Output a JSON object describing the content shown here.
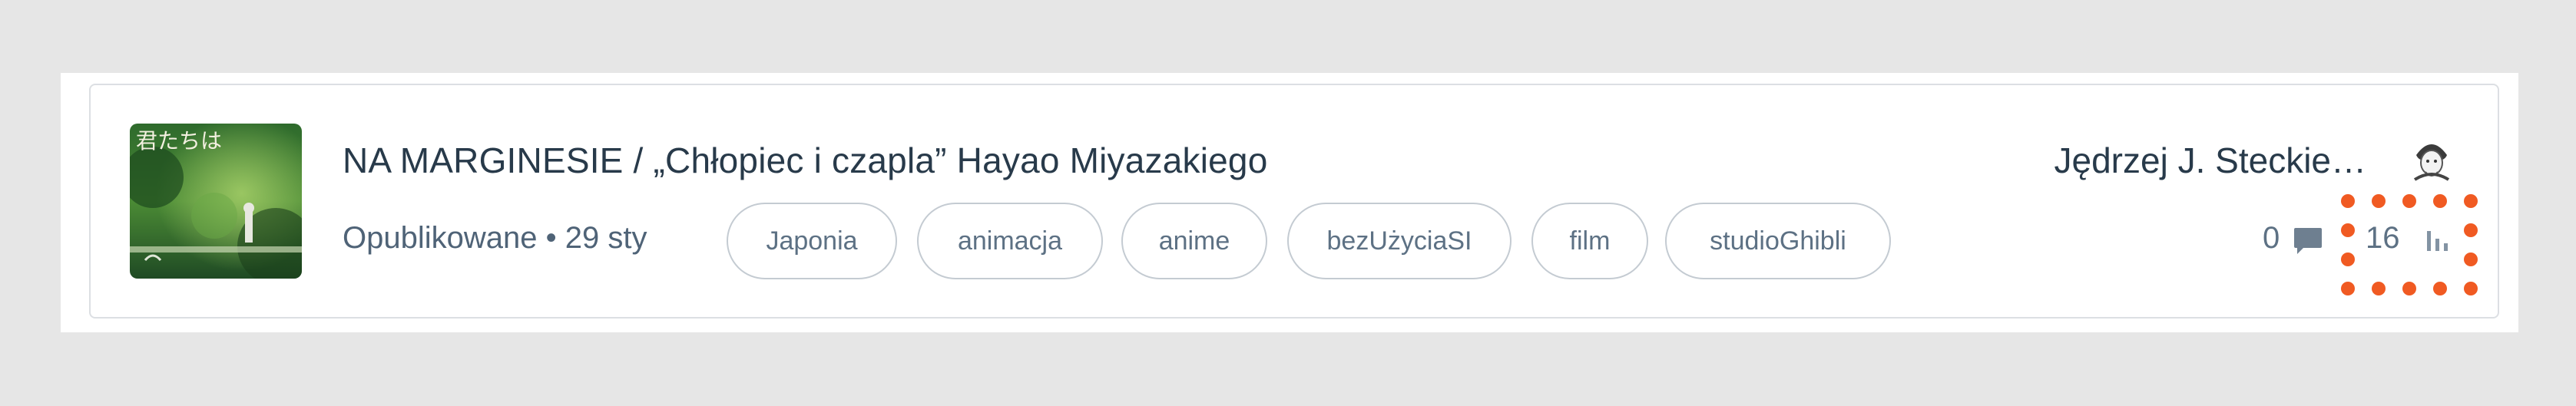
{
  "post": {
    "title": "NA MARGINESIE / „Chłopiec i czapla” Hayao Miyazakiego",
    "status_date": "Opublikowane • 29 sty",
    "tags": [
      "Japonia",
      "animacja",
      "anime",
      "bezUżyciaSI",
      "film",
      "studioGhibli"
    ],
    "author": "Jędrzej J. Steckie…",
    "comments_count": "0",
    "views_count": "16"
  },
  "icons": {
    "comment": "comment-icon",
    "views": "bar-chart-icon"
  },
  "colors": {
    "highlight": "#f05a22",
    "title": "#283a4a",
    "muted": "#5d7184",
    "tag_border": "#c4cbd2"
  }
}
